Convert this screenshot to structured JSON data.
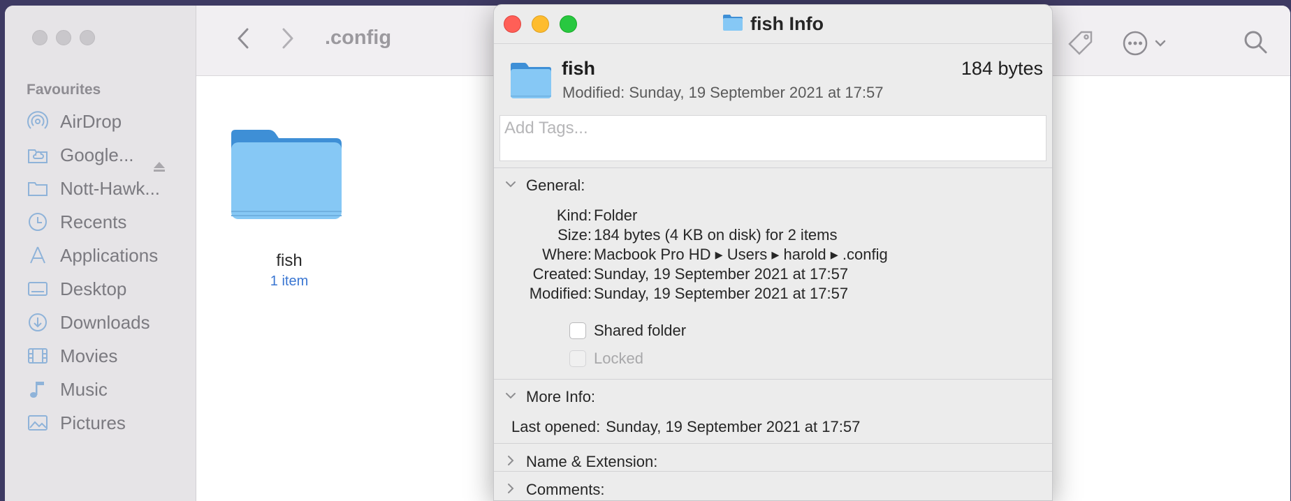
{
  "finder": {
    "path_title": ".config",
    "sidebar": {
      "section": "Favourites",
      "items": [
        {
          "label": "AirDrop",
          "icon": "airdrop-icon"
        },
        {
          "label": "Google...",
          "icon": "cloud-drive-icon"
        },
        {
          "label": "Nott-Hawk...",
          "icon": "folder-icon"
        },
        {
          "label": "Recents",
          "icon": "clock-icon"
        },
        {
          "label": "Applications",
          "icon": "applications-icon"
        },
        {
          "label": "Desktop",
          "icon": "desktop-icon"
        },
        {
          "label": "Downloads",
          "icon": "download-icon"
        },
        {
          "label": "Movies",
          "icon": "film-icon"
        },
        {
          "label": "Music",
          "icon": "music-note-icon"
        },
        {
          "label": "Pictures",
          "icon": "photo-icon"
        }
      ]
    },
    "content": {
      "items": [
        {
          "name": "fish",
          "count": "1 item"
        }
      ]
    }
  },
  "info_window": {
    "title": "fish Info",
    "name": "fish",
    "size_summary": "184 bytes",
    "modified_header": "Modified: Sunday, 19 September 2021 at 17:57",
    "tags_placeholder": "Add Tags...",
    "general": {
      "header": "General:",
      "rows": [
        {
          "key": "Kind:",
          "value": "Folder"
        },
        {
          "key": "Size:",
          "value": "184 bytes (4 KB on disk) for 2 items"
        },
        {
          "key": "Where:",
          "value": "Macbook Pro HD ▸ Users ▸ harold ▸ .config"
        },
        {
          "key": "Created:",
          "value": "Sunday, 19 September 2021 at 17:57"
        },
        {
          "key": "Modified:",
          "value": "Sunday, 19 September 2021 at 17:57"
        }
      ],
      "shared_folder": {
        "label": "Shared folder",
        "checked": false
      },
      "locked": {
        "label": "Locked",
        "checked": false,
        "enabled": false
      }
    },
    "more_info": {
      "header": "More Info:",
      "last_opened_key": "Last opened:",
      "last_opened_value": "Sunday, 19 September 2021 at 17:57"
    },
    "name_extension": {
      "header": "Name & Extension:"
    },
    "comments": {
      "header": "Comments:"
    }
  },
  "colors": {
    "close": "#ff5f57",
    "minimize": "#febc2e",
    "zoom": "#28c840",
    "folder_blue": "#7cc3f1",
    "accent_blue": "#3a76d2"
  }
}
